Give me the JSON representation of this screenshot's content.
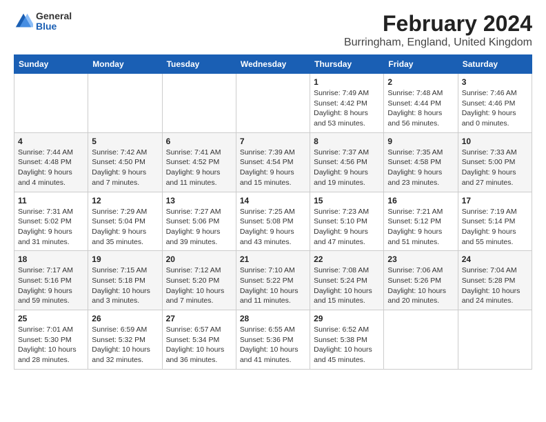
{
  "logo": {
    "general": "General",
    "blue": "Blue"
  },
  "header": {
    "title": "February 2024",
    "subtitle": "Burringham, England, United Kingdom"
  },
  "days_of_week": [
    "Sunday",
    "Monday",
    "Tuesday",
    "Wednesday",
    "Thursday",
    "Friday",
    "Saturday"
  ],
  "weeks": [
    [
      {
        "day": "",
        "info": ""
      },
      {
        "day": "",
        "info": ""
      },
      {
        "day": "",
        "info": ""
      },
      {
        "day": "",
        "info": ""
      },
      {
        "day": "1",
        "info": "Sunrise: 7:49 AM\nSunset: 4:42 PM\nDaylight: 8 hours\nand 53 minutes."
      },
      {
        "day": "2",
        "info": "Sunrise: 7:48 AM\nSunset: 4:44 PM\nDaylight: 8 hours\nand 56 minutes."
      },
      {
        "day": "3",
        "info": "Sunrise: 7:46 AM\nSunset: 4:46 PM\nDaylight: 9 hours\nand 0 minutes."
      }
    ],
    [
      {
        "day": "4",
        "info": "Sunrise: 7:44 AM\nSunset: 4:48 PM\nDaylight: 9 hours\nand 4 minutes."
      },
      {
        "day": "5",
        "info": "Sunrise: 7:42 AM\nSunset: 4:50 PM\nDaylight: 9 hours\nand 7 minutes."
      },
      {
        "day": "6",
        "info": "Sunrise: 7:41 AM\nSunset: 4:52 PM\nDaylight: 9 hours\nand 11 minutes."
      },
      {
        "day": "7",
        "info": "Sunrise: 7:39 AM\nSunset: 4:54 PM\nDaylight: 9 hours\nand 15 minutes."
      },
      {
        "day": "8",
        "info": "Sunrise: 7:37 AM\nSunset: 4:56 PM\nDaylight: 9 hours\nand 19 minutes."
      },
      {
        "day": "9",
        "info": "Sunrise: 7:35 AM\nSunset: 4:58 PM\nDaylight: 9 hours\nand 23 minutes."
      },
      {
        "day": "10",
        "info": "Sunrise: 7:33 AM\nSunset: 5:00 PM\nDaylight: 9 hours\nand 27 minutes."
      }
    ],
    [
      {
        "day": "11",
        "info": "Sunrise: 7:31 AM\nSunset: 5:02 PM\nDaylight: 9 hours\nand 31 minutes."
      },
      {
        "day": "12",
        "info": "Sunrise: 7:29 AM\nSunset: 5:04 PM\nDaylight: 9 hours\nand 35 minutes."
      },
      {
        "day": "13",
        "info": "Sunrise: 7:27 AM\nSunset: 5:06 PM\nDaylight: 9 hours\nand 39 minutes."
      },
      {
        "day": "14",
        "info": "Sunrise: 7:25 AM\nSunset: 5:08 PM\nDaylight: 9 hours\nand 43 minutes."
      },
      {
        "day": "15",
        "info": "Sunrise: 7:23 AM\nSunset: 5:10 PM\nDaylight: 9 hours\nand 47 minutes."
      },
      {
        "day": "16",
        "info": "Sunrise: 7:21 AM\nSunset: 5:12 PM\nDaylight: 9 hours\nand 51 minutes."
      },
      {
        "day": "17",
        "info": "Sunrise: 7:19 AM\nSunset: 5:14 PM\nDaylight: 9 hours\nand 55 minutes."
      }
    ],
    [
      {
        "day": "18",
        "info": "Sunrise: 7:17 AM\nSunset: 5:16 PM\nDaylight: 9 hours\nand 59 minutes."
      },
      {
        "day": "19",
        "info": "Sunrise: 7:15 AM\nSunset: 5:18 PM\nDaylight: 10 hours\nand 3 minutes."
      },
      {
        "day": "20",
        "info": "Sunrise: 7:12 AM\nSunset: 5:20 PM\nDaylight: 10 hours\nand 7 minutes."
      },
      {
        "day": "21",
        "info": "Sunrise: 7:10 AM\nSunset: 5:22 PM\nDaylight: 10 hours\nand 11 minutes."
      },
      {
        "day": "22",
        "info": "Sunrise: 7:08 AM\nSunset: 5:24 PM\nDaylight: 10 hours\nand 15 minutes."
      },
      {
        "day": "23",
        "info": "Sunrise: 7:06 AM\nSunset: 5:26 PM\nDaylight: 10 hours\nand 20 minutes."
      },
      {
        "day": "24",
        "info": "Sunrise: 7:04 AM\nSunset: 5:28 PM\nDaylight: 10 hours\nand 24 minutes."
      }
    ],
    [
      {
        "day": "25",
        "info": "Sunrise: 7:01 AM\nSunset: 5:30 PM\nDaylight: 10 hours\nand 28 minutes."
      },
      {
        "day": "26",
        "info": "Sunrise: 6:59 AM\nSunset: 5:32 PM\nDaylight: 10 hours\nand 32 minutes."
      },
      {
        "day": "27",
        "info": "Sunrise: 6:57 AM\nSunset: 5:34 PM\nDaylight: 10 hours\nand 36 minutes."
      },
      {
        "day": "28",
        "info": "Sunrise: 6:55 AM\nSunset: 5:36 PM\nDaylight: 10 hours\nand 41 minutes."
      },
      {
        "day": "29",
        "info": "Sunrise: 6:52 AM\nSunset: 5:38 PM\nDaylight: 10 hours\nand 45 minutes."
      },
      {
        "day": "",
        "info": ""
      },
      {
        "day": "",
        "info": ""
      }
    ]
  ]
}
